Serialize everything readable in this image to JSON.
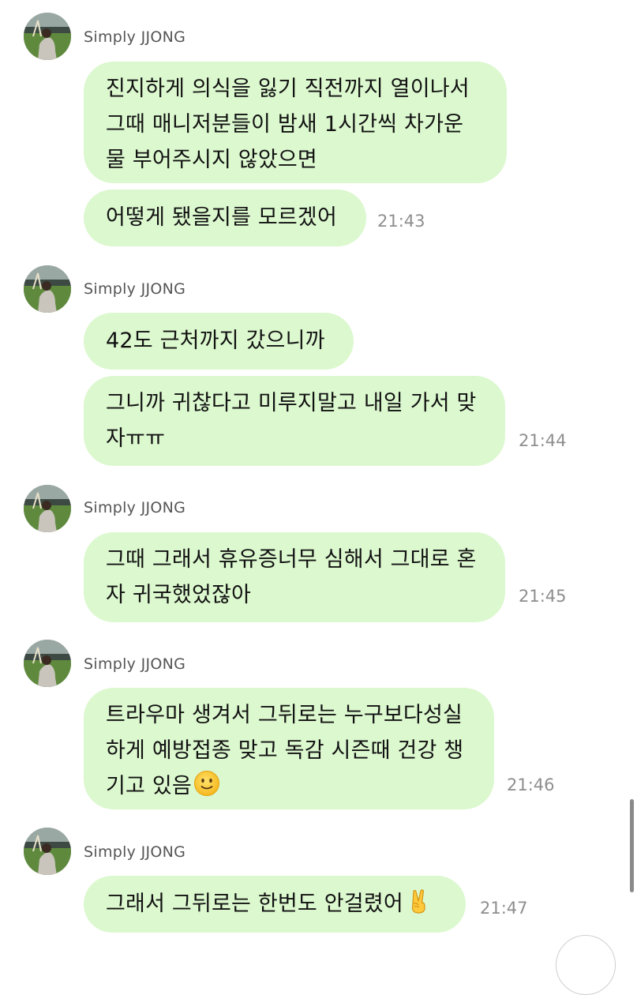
{
  "sender_name": "Simply JJONG",
  "groups": [
    {
      "sender": "Simply JJONG",
      "bubbles": [
        {
          "lines": [
            "진지하게 의식을 잃기 직전까지 열이나서",
            "그때 매니저분들이 밤새 1시간씩 차가운",
            "물 부어주시지 않았으면"
          ]
        },
        {
          "lines": [
            "어떻게 됐을지를 모르겠어"
          ],
          "time": "21:43"
        }
      ]
    },
    {
      "sender": "Simply JJONG",
      "bubbles": [
        {
          "lines": [
            "42도 근처까지 갔으니까"
          ]
        },
        {
          "lines": [
            "그니까 귀찮다고 미루지말고 내일 가서 맞",
            "자ㅠㅠ"
          ],
          "time": "21:44"
        }
      ]
    },
    {
      "sender": "Simply JJONG",
      "bubbles": [
        {
          "lines": [
            "그때 그래서 휴유증너무 심해서 그대로 혼",
            "자 귀국했었잖아"
          ],
          "time": "21:45"
        }
      ]
    },
    {
      "sender": "Simply JJONG",
      "bubbles": [
        {
          "lines": [
            "트라우마 생겨서 그뒤로는 누구보다성실",
            "하게 예방접종 맞고 독감 시즌때 건강 챙",
            "기고 있음"
          ],
          "trailing_emoji": "slightly-smiling-face-icon",
          "time": "21:46"
        }
      ]
    },
    {
      "sender": "Simply JJONG",
      "bubbles": [
        {
          "lines": [
            "그래서 그뒤로는 한번도 안걸렸어"
          ],
          "trailing_emoji": "victory-hand-icon",
          "time": "21:47"
        }
      ]
    }
  ],
  "colors": {
    "bubble_bg": "#dcf8cf",
    "text": "#111111",
    "sender_text": "#555555",
    "time_text": "#8e8e8e"
  }
}
